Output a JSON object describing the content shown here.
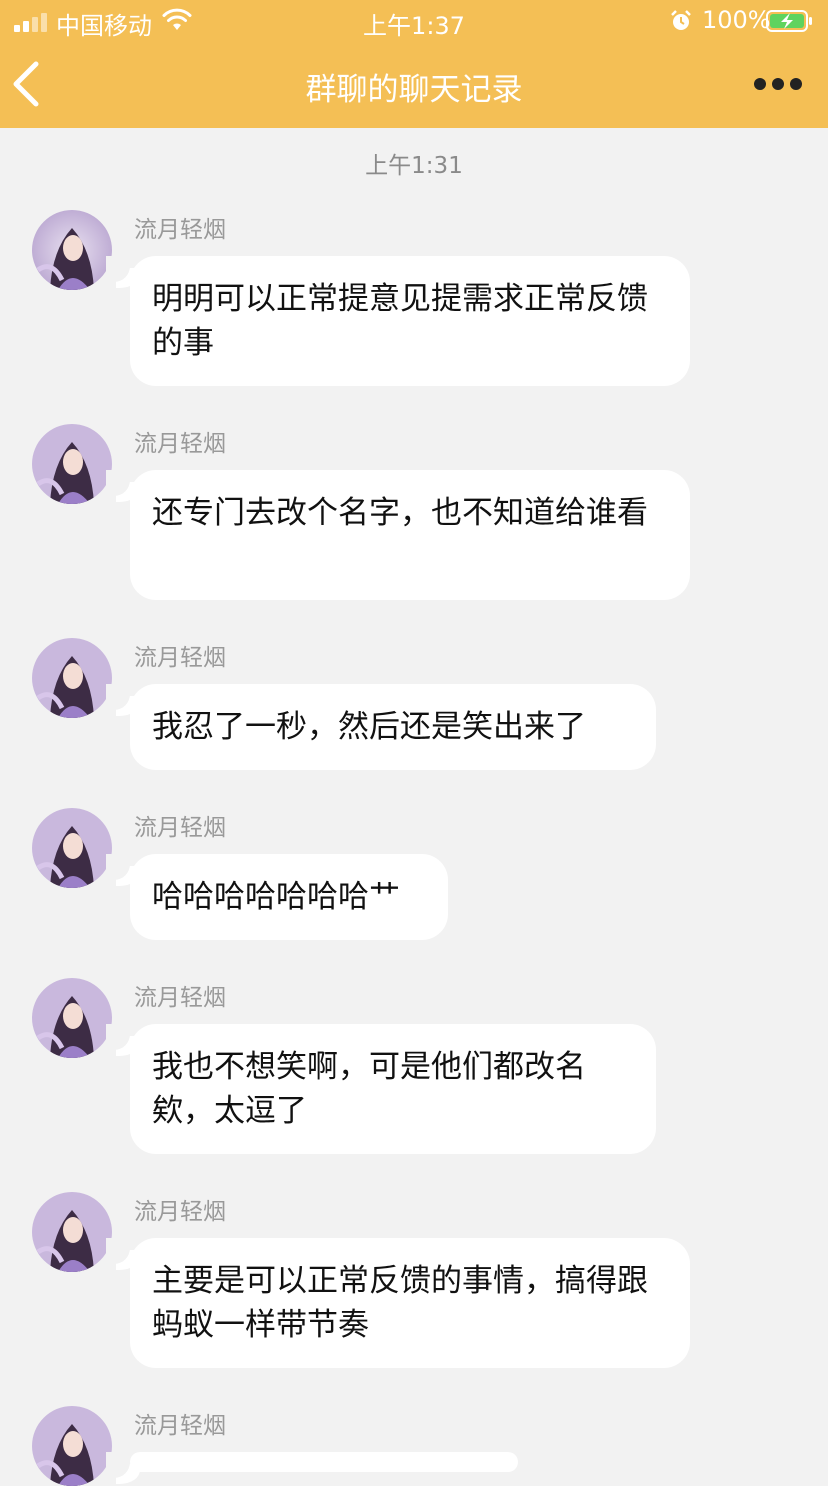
{
  "status_bar": {
    "carrier": "中国移动",
    "time": "上午1:37",
    "battery": "100%"
  },
  "nav": {
    "title": "群聊的聊天记录"
  },
  "chat": {
    "timestamp": "上午1:31",
    "messages": [
      {
        "sender": "流月轻烟",
        "text": "明明可以正常提意见提需求正常反馈的事"
      },
      {
        "sender": "流月轻烟",
        "text": "还专门去改个名字，也不知道给谁看"
      },
      {
        "sender": "流月轻烟",
        "text": "我忍了一秒，然后还是笑出来了"
      },
      {
        "sender": "流月轻烟",
        "text": "哈哈哈哈哈哈哈艹"
      },
      {
        "sender": "流月轻烟",
        "text": "我也不想笑啊，可是他们都改名欸，太逗了"
      },
      {
        "sender": "流月轻烟",
        "text": "主要是可以正常反馈的事情，搞得跟蚂蚁一样带节奏"
      },
      {
        "sender": "流月轻烟",
        "text": ""
      }
    ]
  },
  "colors": {
    "header": "#f4bf55",
    "background": "#f2f2f2",
    "bubble": "#ffffff"
  }
}
